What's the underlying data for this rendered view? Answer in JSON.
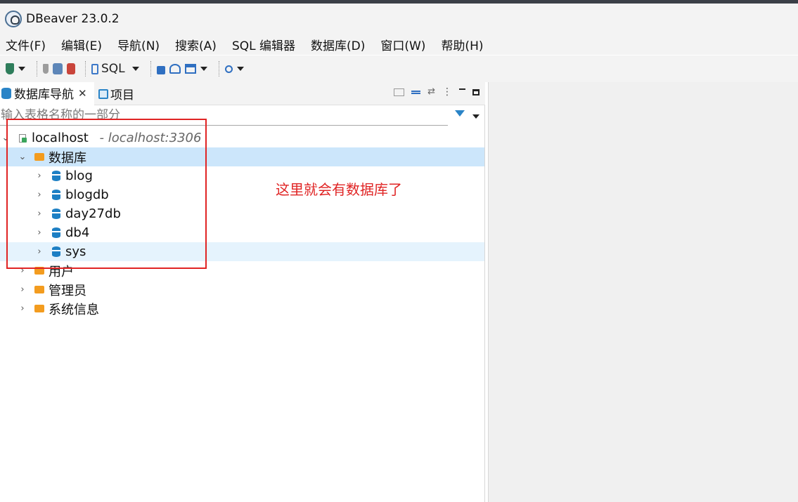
{
  "window": {
    "title": "DBeaver 23.0.2"
  },
  "menu": [
    "文件(F)",
    "编辑(E)",
    "导航(N)",
    "搜索(A)",
    "SQL 编辑器",
    "数据库(D)",
    "窗口(W)",
    "帮助(H)"
  ],
  "toolbar": {
    "sql_label": "SQL"
  },
  "navigator": {
    "tab_active": "数据库导航",
    "tab_close": "✕",
    "tab_project": "项目",
    "filter_placeholder": "输入表格名称的一部分",
    "connection": {
      "name": "localhost",
      "detail": " - localhost:3306"
    },
    "databases_folder": "数据库",
    "databases": [
      "blog",
      "blogdb",
      "day27db",
      "db4",
      "sys"
    ],
    "folders": [
      "用户",
      "管理员",
      "系统信息"
    ]
  },
  "annotation": {
    "text": "这里就会有数据库了",
    "color": "#e02424"
  },
  "colors": {
    "selected_row": "#cce6fb",
    "hover_row": "#e5f3fd",
    "db_icon": "#1d7fc4",
    "folder_icon": "#f39c1f"
  }
}
